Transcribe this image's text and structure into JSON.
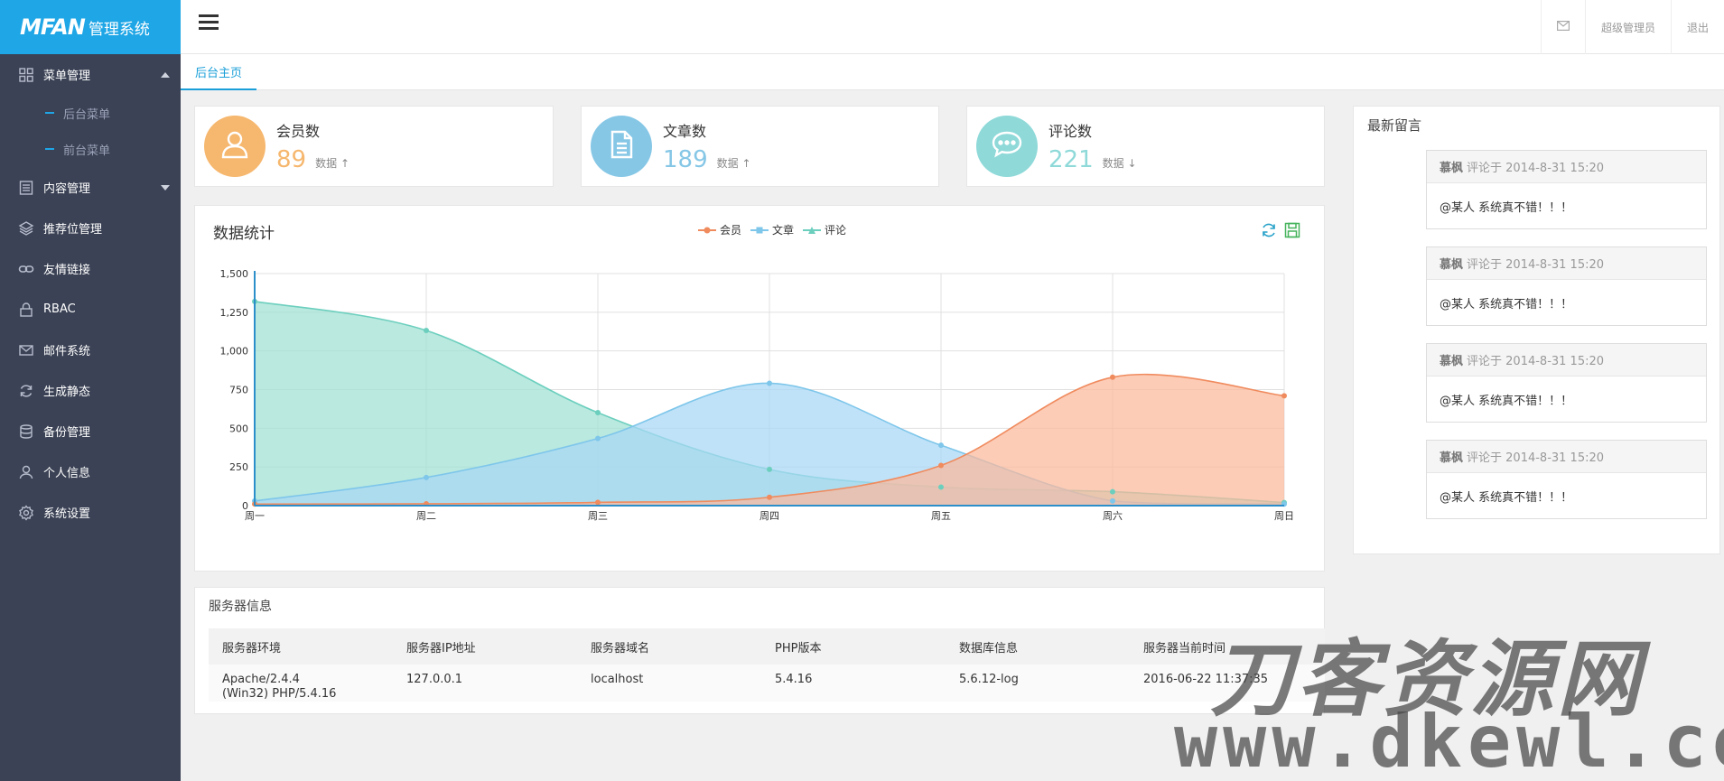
{
  "app": {
    "brand": "MFAN",
    "title": "管理系统"
  },
  "sidebar": {
    "items": [
      {
        "label": "菜单管理",
        "icon": "grid-icon",
        "expanded": true,
        "children": [
          {
            "label": "后台菜单"
          },
          {
            "label": "前台菜单"
          }
        ]
      },
      {
        "label": "内容管理",
        "icon": "list-icon",
        "expanded": false
      },
      {
        "label": "推荐位管理",
        "icon": "layers-icon"
      },
      {
        "label": "友情链接",
        "icon": "link-icon"
      },
      {
        "label": "RBAC",
        "icon": "lock-icon"
      },
      {
        "label": "邮件系统",
        "icon": "mail-icon"
      },
      {
        "label": "生成静态",
        "icon": "refresh-icon"
      },
      {
        "label": "备份管理",
        "icon": "database-icon"
      },
      {
        "label": "个人信息",
        "icon": "user-icon"
      },
      {
        "label": "系统设置",
        "icon": "gear-icon"
      }
    ]
  },
  "header": {
    "admin": "超级管理员",
    "logout": "退出"
  },
  "tabs": [
    {
      "label": "后台主页",
      "active": true
    }
  ],
  "stats": [
    {
      "label": "会员数",
      "value": "89",
      "sub": "数据",
      "trend": "up",
      "color": "#f6b76e",
      "icon": "user-icon"
    },
    {
      "label": "文章数",
      "value": "189",
      "sub": "数据",
      "trend": "up",
      "color": "#86c7e6",
      "icon": "document-icon"
    },
    {
      "label": "评论数",
      "value": "221",
      "sub": "数据",
      "trend": "down",
      "color": "#8fd9d9",
      "icon": "chat-icon"
    }
  ],
  "chart": {
    "title": "数据统计"
  },
  "chart_data": {
    "type": "area",
    "categories": [
      "周一",
      "周二",
      "周三",
      "周四",
      "周五",
      "周六",
      "周日"
    ],
    "series": [
      {
        "name": "会员",
        "color": "#f08b5e",
        "fill": "#fbb99b",
        "values": [
          10,
          12,
          21,
          54,
          260,
          830,
          710
        ]
      },
      {
        "name": "文章",
        "color": "#7ec6ea",
        "fill": "#a8d7f5",
        "values": [
          30,
          182,
          434,
          791,
          390,
          30,
          10
        ]
      },
      {
        "name": "评论",
        "color": "#6ccfbe",
        "fill": "#9fe0d3",
        "values": [
          1320,
          1132,
          601,
          234,
          120,
          90,
          20
        ]
      }
    ],
    "ylim": [
      0,
      1500
    ],
    "yticks": [
      "0",
      "250",
      "500",
      "750",
      "1,000",
      "1,250",
      "1,500"
    ],
    "grid": true,
    "legend": "top-center"
  },
  "server": {
    "title": "服务器信息",
    "headers": [
      "服务器环境",
      "服务器IP地址",
      "服务器域名",
      "PHP版本",
      "数据库信息",
      "服务器当前时间"
    ],
    "rows": [
      [
        "Apache/2.4.4 (Win32) PHP/5.4.16",
        "127.0.0.1",
        "localhost",
        "5.4.16",
        "5.6.12-log",
        "2016-06-22 11:37:35"
      ]
    ]
  },
  "comments": {
    "title": "最新留言",
    "items": [
      {
        "author": "慕枫",
        "meta": "评论于 2014-8-31 15:20",
        "text": "@某人 系统真不错！！！"
      },
      {
        "author": "慕枫",
        "meta": "评论于 2014-8-31 15:20",
        "text": "@某人 系统真不错！！！"
      },
      {
        "author": "慕枫",
        "meta": "评论于 2014-8-31 15:20",
        "text": "@某人 系统真不错！！！"
      },
      {
        "author": "慕枫",
        "meta": "评论于 2014-8-31 15:20",
        "text": "@某人 系统真不错！！！"
      }
    ]
  },
  "watermark": {
    "line1": "刀客资源网",
    "line2": "www.dkewl.com"
  }
}
